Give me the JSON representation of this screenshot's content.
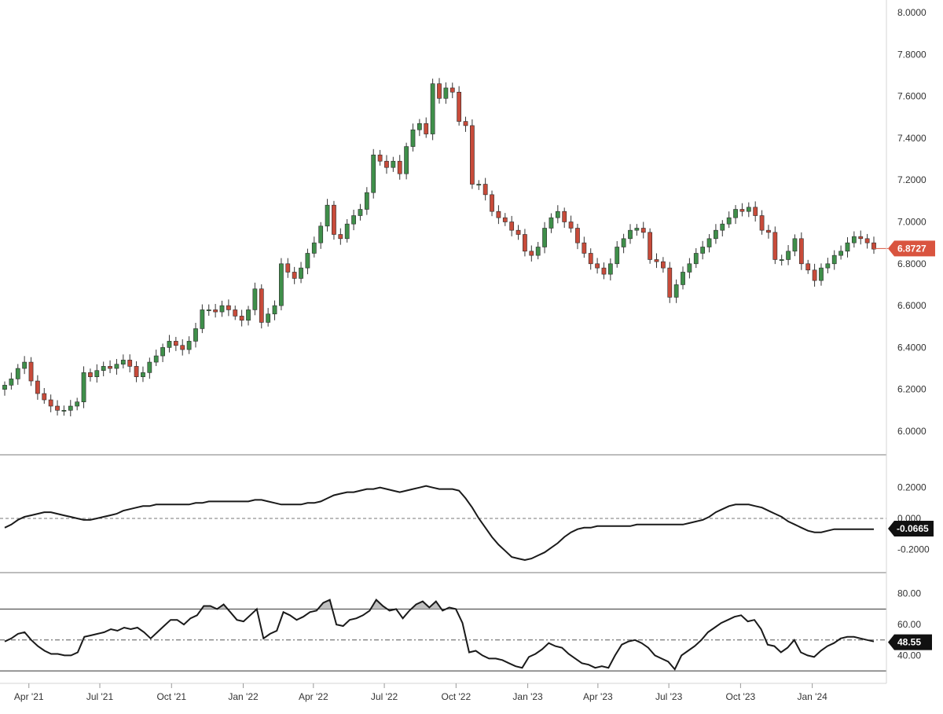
{
  "chart_data": [
    {
      "type": "candlestick",
      "name": "price",
      "x_range": [
        "2021-03-01",
        "2024-03-20"
      ],
      "ylim": [
        6.0,
        8.0
      ],
      "y_ticks": [
        "6.0000",
        "6.2000",
        "6.4000",
        "6.6000",
        "6.8000",
        "7.0000",
        "7.2000",
        "7.4000",
        "7.6000",
        "7.8000",
        "8.0000"
      ],
      "last_value_label": "6.8727",
      "colors": {
        "up": "#3f8f4a",
        "down": "#c84b3a",
        "wick": "#333333",
        "tag": "#d9543f"
      },
      "close": [
        6.22,
        6.25,
        6.3,
        6.33,
        6.24,
        6.18,
        6.15,
        6.12,
        6.1,
        6.1,
        6.12,
        6.14,
        6.28,
        6.26,
        6.29,
        6.31,
        6.3,
        6.32,
        6.34,
        6.31,
        6.26,
        6.28,
        6.33,
        6.36,
        6.4,
        6.43,
        6.41,
        6.39,
        6.43,
        6.49,
        6.58,
        6.58,
        6.57,
        6.6,
        6.58,
        6.55,
        6.53,
        6.58,
        6.68,
        6.52,
        6.56,
        6.6,
        6.8,
        6.76,
        6.73,
        6.78,
        6.85,
        6.9,
        6.98,
        7.08,
        6.94,
        6.92,
        6.99,
        7.03,
        7.06,
        7.14,
        7.32,
        7.29,
        7.26,
        7.29,
        7.23,
        7.36,
        7.44,
        7.47,
        7.42,
        7.66,
        7.59,
        7.64,
        7.62,
        7.48,
        7.46,
        7.18,
        7.18,
        7.13,
        7.05,
        7.02,
        7.0,
        6.96,
        6.94,
        6.86,
        6.84,
        6.88,
        6.97,
        7.02,
        7.05,
        7.0,
        6.97,
        6.9,
        6.85,
        6.8,
        6.78,
        6.75,
        6.8,
        6.88,
        6.92,
        6.96,
        6.97,
        6.95,
        6.82,
        6.81,
        6.78,
        6.64,
        6.7,
        6.76,
        6.8,
        6.85,
        6.88,
        6.92,
        6.96,
        6.99,
        7.02,
        7.06,
        7.05,
        7.07,
        7.03,
        6.96,
        6.95,
        6.82,
        6.82,
        6.86,
        6.92,
        6.8,
        6.77,
        6.72,
        6.78,
        6.8,
        6.84,
        6.86,
        6.9,
        6.93,
        6.92,
        6.9,
        6.87
      ]
    },
    {
      "type": "line",
      "name": "oscillator",
      "x_range": [
        "2021-03-01",
        "2024-03-20"
      ],
      "ylim": [
        -0.28,
        0.29
      ],
      "y_ticks": [
        "-0.2000",
        "0.000",
        "0.2000"
      ],
      "zero_line": 0.0,
      "last_value_label": "-0.0665",
      "values": [
        -0.06,
        -0.04,
        -0.01,
        0.01,
        0.02,
        0.03,
        0.04,
        0.04,
        0.03,
        0.02,
        0.01,
        0.0,
        -0.01,
        -0.01,
        0.0,
        0.01,
        0.02,
        0.03,
        0.05,
        0.06,
        0.07,
        0.08,
        0.08,
        0.09,
        0.09,
        0.09,
        0.09,
        0.09,
        0.09,
        0.1,
        0.1,
        0.11,
        0.11,
        0.11,
        0.11,
        0.11,
        0.11,
        0.11,
        0.12,
        0.12,
        0.11,
        0.1,
        0.09,
        0.09,
        0.09,
        0.09,
        0.1,
        0.1,
        0.11,
        0.13,
        0.15,
        0.16,
        0.17,
        0.17,
        0.18,
        0.19,
        0.19,
        0.2,
        0.19,
        0.18,
        0.17,
        0.18,
        0.19,
        0.2,
        0.21,
        0.2,
        0.19,
        0.19,
        0.19,
        0.18,
        0.13,
        0.07,
        0.0,
        -0.06,
        -0.12,
        -0.17,
        -0.21,
        -0.25,
        -0.26,
        -0.27,
        -0.26,
        -0.24,
        -0.22,
        -0.19,
        -0.16,
        -0.12,
        -0.09,
        -0.07,
        -0.06,
        -0.06,
        -0.05,
        -0.05,
        -0.05,
        -0.05,
        -0.05,
        -0.05,
        -0.04,
        -0.04,
        -0.04,
        -0.04,
        -0.04,
        -0.04,
        -0.04,
        -0.04,
        -0.03,
        -0.02,
        -0.01,
        0.01,
        0.04,
        0.06,
        0.08,
        0.09,
        0.09,
        0.09,
        0.08,
        0.07,
        0.05,
        0.03,
        0.01,
        -0.02,
        -0.04,
        -0.06,
        -0.08,
        -0.09,
        -0.09,
        -0.08,
        -0.07,
        -0.07,
        -0.07,
        -0.07,
        -0.07,
        -0.07,
        -0.07
      ]
    },
    {
      "type": "line",
      "name": "rsi",
      "x_range": [
        "2021-03-01",
        "2024-03-20"
      ],
      "ylim": [
        27,
        88
      ],
      "y_ticks": [
        "40.00",
        "60.00",
        "80.00"
      ],
      "levels": [
        30,
        70
      ],
      "mid_level": 50,
      "last_value_label": "48.55",
      "values": [
        49,
        51,
        54,
        55,
        50,
        46,
        43,
        41,
        41,
        40,
        40,
        42,
        52,
        53,
        54,
        55,
        57,
        56,
        58,
        57,
        58,
        55,
        51,
        55,
        59,
        63,
        63,
        60,
        64,
        66,
        72,
        72,
        70,
        73,
        68,
        63,
        62,
        66,
        70,
        51,
        54,
        56,
        68,
        66,
        63,
        65,
        68,
        69,
        74,
        76,
        60,
        59,
        63,
        64,
        66,
        69,
        76,
        72,
        69,
        70,
        64,
        69,
        73,
        75,
        71,
        75,
        69,
        71,
        70,
        61,
        42,
        43,
        40,
        38,
        38,
        37,
        35,
        33,
        32,
        39,
        41,
        44,
        48,
        46,
        45,
        41,
        38,
        35,
        34,
        32,
        33,
        32,
        40,
        47,
        49,
        50,
        48,
        45,
        40,
        38,
        36,
        31,
        40,
        43,
        46,
        50,
        55,
        58,
        61,
        63,
        65,
        66,
        62,
        63,
        57,
        47,
        46,
        42,
        45,
        50,
        42,
        40,
        39,
        43,
        46,
        48,
        51,
        52,
        52,
        51,
        50,
        49
      ]
    }
  ],
  "x_axis": {
    "ticks": [
      {
        "label": "Apr '21",
        "date": "2021-04-01"
      },
      {
        "label": "Jul '21",
        "date": "2021-07-01"
      },
      {
        "label": "Oct '21",
        "date": "2021-10-01"
      },
      {
        "label": "Jan '22",
        "date": "2022-01-01"
      },
      {
        "label": "Apr '22",
        "date": "2022-04-01"
      },
      {
        "label": "Jul '22",
        "date": "2022-07-01"
      },
      {
        "label": "Oct '22",
        "date": "2022-10-01"
      },
      {
        "label": "Jan '23",
        "date": "2023-01-01"
      },
      {
        "label": "Apr '23",
        "date": "2023-04-01"
      },
      {
        "label": "Jul '23",
        "date": "2023-07-01"
      },
      {
        "label": "Oct '23",
        "date": "2023-10-01"
      },
      {
        "label": "Jan '24",
        "date": "2024-01-01"
      }
    ]
  }
}
